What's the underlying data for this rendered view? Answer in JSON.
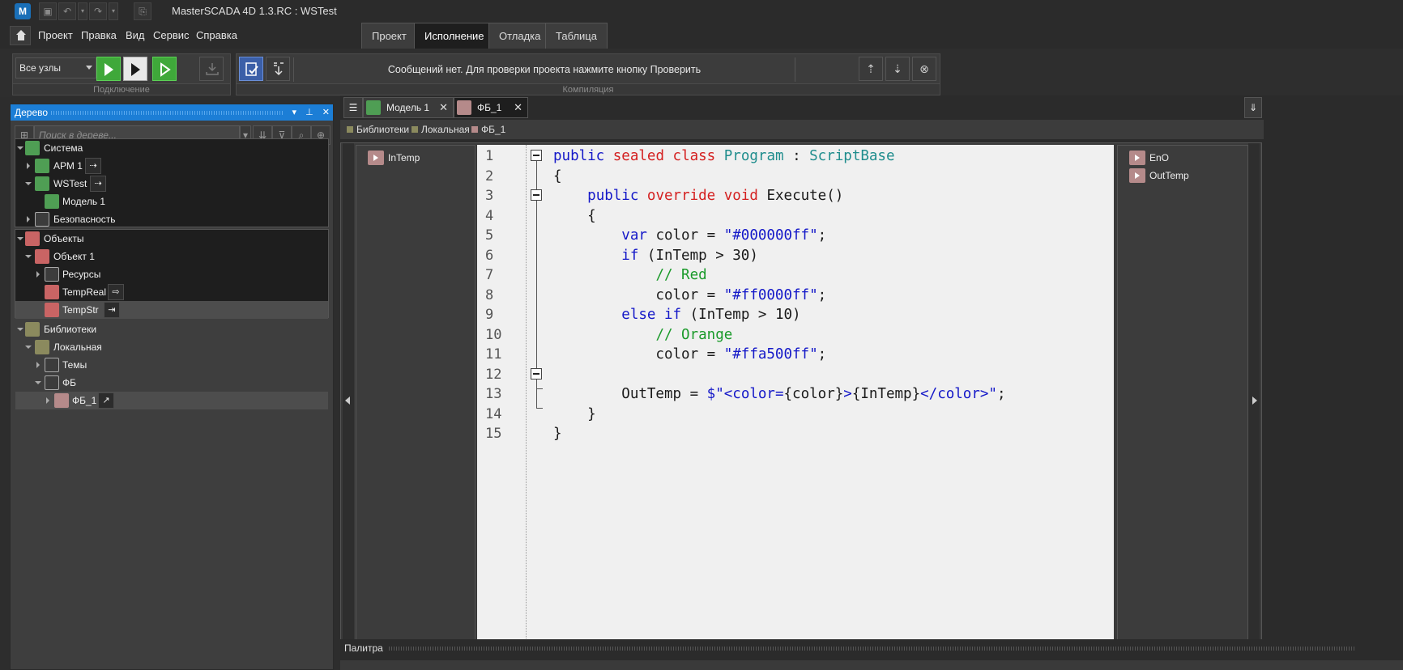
{
  "titlebar": {
    "app_logo": "M",
    "title": "MasterSCADA 4D 1.3.RC :  WSTest",
    "quick_access": [
      "save-icon",
      "undo-icon",
      "redo-icon",
      "clipboard-icon"
    ]
  },
  "menu": {
    "items": [
      "Проект",
      "Правка",
      "Вид",
      "Сервис",
      "Справка"
    ]
  },
  "ribbon_tabs": {
    "items": [
      "Проект",
      "Исполнение",
      "Отладка",
      "Таблица"
    ],
    "active": "Исполнение"
  },
  "ribbon": {
    "node_select": "Все узлы",
    "connection_group": "Подключение",
    "compile_group": "Компиляция",
    "message": "Сообщений нет. Для проверки проекта нажмите кнопку Проверить"
  },
  "tree": {
    "title": "Дерево",
    "search_placeholder": "Поиск в дереве...",
    "system": {
      "label": "Система",
      "items": [
        "АРМ 1",
        "WSTest",
        "Модель 1",
        "Безопасность"
      ]
    },
    "objects": {
      "label": "Объекты",
      "items": [
        "Объект 1",
        "Ресурсы",
        "TempReal",
        "TempStr"
      ]
    },
    "libraries": {
      "label": "Библиотеки",
      "items": [
        "Локальная",
        "Темы",
        "ФБ",
        "ФБ_1"
      ]
    }
  },
  "doc_tabs": {
    "items": [
      "Модель 1",
      "ФБ_1"
    ],
    "active": "ФБ_1"
  },
  "breadcrumb": {
    "items": [
      "Библиотеки",
      "Локальная",
      "ФБ_1"
    ],
    "colors": [
      "#8b8a5e",
      "#8b8a5e",
      "#b58a8a"
    ]
  },
  "fb": {
    "inputs": [
      "InTemp"
    ],
    "outputs": [
      "EnO",
      "OutTemp"
    ]
  },
  "code": {
    "line_numbers": [
      "1",
      "2",
      "3",
      "4",
      "5",
      "6",
      "7",
      "8",
      "9",
      "10",
      "11",
      "12",
      "13",
      "14",
      "15"
    ],
    "lines": [
      "public sealed class Program : ScriptBase",
      "{",
      "    public override void Execute()",
      "    {",
      "        var color = \"#000000ff\";",
      "        if (InTemp > 30)",
      "            // Red",
      "            color = \"#ff0000ff\";",
      "        else if (InTemp > 10)",
      "            // Orange",
      "            color = \"#ffa500ff\";",
      "",
      "        OutTemp = $\"<color={color}>{InTemp}</color>\";",
      "    }",
      "}"
    ]
  },
  "palette": {
    "title": "Палитра"
  },
  "colors": {
    "accent": "#1c7ed6",
    "run_green": "#3fa83a",
    "keyword": "#1418c8",
    "modifier": "#d42020",
    "type": "#1f8d8d",
    "comment": "#1a9a2a"
  }
}
